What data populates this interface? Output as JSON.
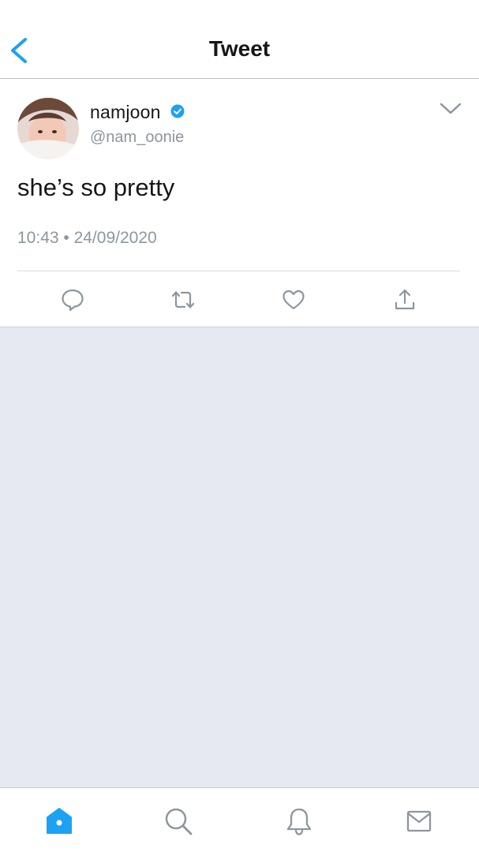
{
  "header": {
    "title": "Tweet",
    "back_icon": "chevron-left-icon"
  },
  "tweet": {
    "display_name": "namjoon",
    "verified": true,
    "handle": "@nam_oonie",
    "text": "she’s so pretty",
    "timestamp": "10:43 • 24/09/2020",
    "more_icon": "chevron-down-icon",
    "actions": [
      "reply-icon",
      "retweet-icon",
      "like-icon",
      "share-icon"
    ]
  },
  "tabbar": {
    "tabs": [
      "home-icon",
      "search-icon",
      "notifications-icon",
      "messages-icon"
    ],
    "active": "home-icon"
  },
  "colors": {
    "accent": "#1da1f2",
    "icon_gray": "#8d969e",
    "text": "#14171a",
    "background_empty": "#e6e9f1"
  }
}
